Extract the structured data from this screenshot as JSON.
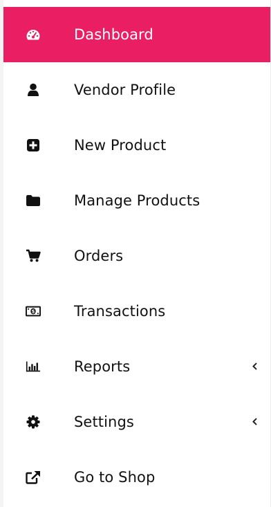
{
  "sidebar": {
    "accent_color": "#ea1f63",
    "items": [
      {
        "label": "Dashboard",
        "icon": "dashboard-icon",
        "active": true,
        "has_submenu": false
      },
      {
        "label": "Vendor Profile",
        "icon": "user-icon",
        "active": false,
        "has_submenu": false
      },
      {
        "label": "New Product",
        "icon": "plus-square-icon",
        "active": false,
        "has_submenu": false
      },
      {
        "label": "Manage Products",
        "icon": "folder-icon",
        "active": false,
        "has_submenu": false
      },
      {
        "label": "Orders",
        "icon": "cart-icon",
        "active": false,
        "has_submenu": false
      },
      {
        "label": "Transactions",
        "icon": "money-icon",
        "active": false,
        "has_submenu": false
      },
      {
        "label": "Reports",
        "icon": "bar-chart-icon",
        "active": false,
        "has_submenu": true
      },
      {
        "label": "Settings",
        "icon": "gear-icon",
        "active": false,
        "has_submenu": true
      },
      {
        "label": "Go to Shop",
        "icon": "external-link-icon",
        "active": false,
        "has_submenu": false
      }
    ]
  }
}
